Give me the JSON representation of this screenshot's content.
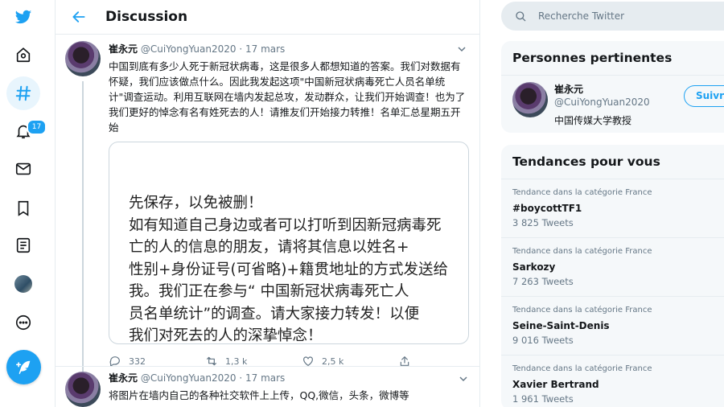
{
  "colors": {
    "accent": "#1da1f2",
    "border": "#e6ecf0",
    "muted": "#657786"
  },
  "nav": {
    "items": [
      {
        "name": "twitter-logo-icon"
      },
      {
        "name": "home-icon"
      },
      {
        "name": "explore-hashtag-icon"
      },
      {
        "name": "notifications-bell-icon",
        "badge": "17"
      },
      {
        "name": "messages-envelope-icon"
      },
      {
        "name": "bookmarks-icon"
      },
      {
        "name": "lists-icon"
      },
      {
        "name": "profile-avatar"
      },
      {
        "name": "more-icon"
      },
      {
        "name": "compose-tweet-icon"
      }
    ]
  },
  "header": {
    "title": "Discussion"
  },
  "tweet1": {
    "name": "崔永元",
    "handle": "@CuiYongYuan2020",
    "date": "· 17 mars",
    "text": "中国到底有多少人死于新冠状病毒，这是很多人都想知道的答案。我们对数据有怀疑，我们应该做点什么。因此我发起这项\"中国新冠状病毒死亡人员名单统计\"调查运动。利用互联网在墙内发起总攻，发动群众，让我们开始调查！也为了我们更好的悼念有名有姓死去的人！请推友们开始接力转推！名单汇总星期五开始",
    "media_text": "先保存，以免被删！\n如有知道自己身边或者可以打听到因新冠病毒死亡的人的信息的朋友，请将其信息以姓名+性别+身份证号(可省略)+籍贯地址的方式发送给我。我们正在参与“ 中国新冠状病毒死亡人员名单统计”的调查。请大家接力转发！以便我们对死去的人的深挚悼念！",
    "replies": "332",
    "retweets": "1,3 k",
    "likes": "2,5 k"
  },
  "tweet2": {
    "name": "崔永元",
    "handle": "@CuiYongYuan2020",
    "date": "· 17 mars",
    "text": "将图片在墙内自己的各种社交软件上上传，QQ,微信，头条，微博等"
  },
  "search": {
    "placeholder": "Recherche Twitter"
  },
  "people": {
    "title": "Personnes pertinentes",
    "name": "崔永元",
    "handle": "@CuiYongYuan2020",
    "bio": "中国传媒大学教授",
    "follow_label": "Suivre"
  },
  "trends": {
    "title": "Tendances pour vous",
    "items": [
      {
        "category": "Tendance dans la catégorie France",
        "name": "#boycottTF1",
        "count": "3 825 Tweets"
      },
      {
        "category": "Tendance dans la catégorie France",
        "name": "Sarkozy",
        "count": "7 263 Tweets"
      },
      {
        "category": "Tendance dans la catégorie France",
        "name": "Seine-Saint-Denis",
        "count": "9 016 Tweets"
      },
      {
        "category": "Tendance dans la catégorie France",
        "name": "Xavier Bertrand",
        "count": "1 961 Tweets"
      }
    ]
  }
}
